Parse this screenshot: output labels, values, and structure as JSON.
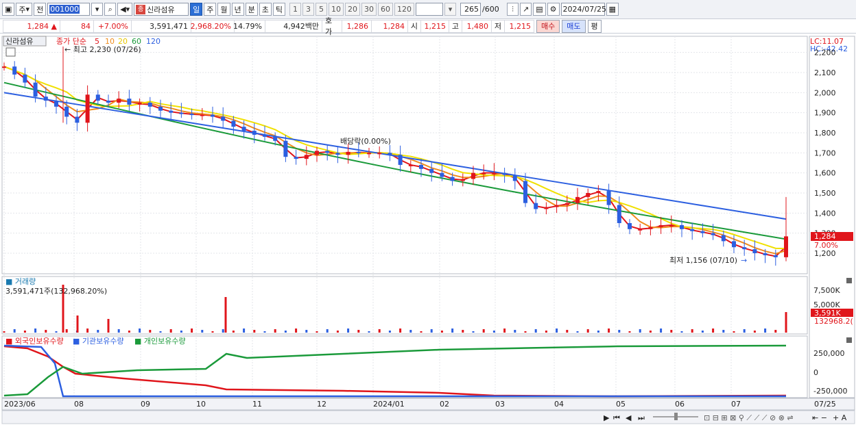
{
  "toolbar": {
    "period_btn": "주",
    "prev_btn": "전",
    "code": "001000",
    "stock_name": "신라섬유",
    "period_tabs": [
      "일",
      "주",
      "월",
      "년",
      "분",
      "초",
      "틱"
    ],
    "interval_tabs": [
      "1",
      "3",
      "5",
      "10",
      "20",
      "30",
      "60",
      "120"
    ],
    "count": "265",
    "count_max": "/600",
    "date": "2024/07/25",
    "logo_char": "종"
  },
  "quote": {
    "price": "1,284",
    "arrow": "▲",
    "change": "84",
    "change_pct": "+7.00%",
    "volume": "3,591,471",
    "volume_ratio": "2,968.20%",
    "turnover": "14.79%",
    "amount": "4,942백만",
    "bid_label": "호가",
    "bid": "1,286",
    "ask": "1,284",
    "open_label": "시",
    "open": "1,215",
    "high_label": "고",
    "high": "1,480",
    "low_label": "저",
    "low": "1,215",
    "buy_btn": "매수",
    "sell_btn": "매도",
    "eval_btn": "평"
  },
  "main_panel": {
    "name_tag": "신라섬유",
    "legend_prefix": "종가 단순",
    "ma_labels": [
      "5",
      "10",
      "20",
      "60",
      "120"
    ],
    "ma_colors": [
      "#e0151b",
      "#f08c1c",
      "#f0e000",
      "#1a9a3a",
      "#2c5fe0"
    ],
    "high_note": "최고 2,230 (07/26)",
    "low_note": "최저 1,156 (07/10)",
    "dividend_note": "배당락(0.00%)",
    "lc": "LC:11.07",
    "hc": "HC:-42.42",
    "y_ticks": [
      "2,200",
      "2,100",
      "2,000",
      "1,900",
      "1,800",
      "1,700",
      "1,600",
      "1,500",
      "1,400",
      "1,300",
      "1,200"
    ],
    "price_tag": "1,284",
    "pct_tag": "7.00%"
  },
  "volume_panel": {
    "title": "거래량",
    "value": "3,591,471주(132,968.20%)",
    "y_ticks": [
      "7,500K",
      "5,000K"
    ],
    "tag": "3,591K",
    "tag2": "132968.2("
  },
  "holdings_panel": {
    "legend": [
      "외국인보유수량",
      "기관보유수량",
      "개인보유수량"
    ],
    "colors": [
      "#e0151b",
      "#2c5fe0",
      "#1a9a3a"
    ],
    "y_ticks": [
      "250,000",
      "0",
      "-250,000"
    ]
  },
  "x_axis": {
    "labels": [
      "2023/06",
      "08",
      "09",
      "10",
      "11",
      "12",
      "2024/01",
      "02",
      "03",
      "04",
      "05",
      "06",
      "07"
    ],
    "last_label": "07/25"
  },
  "chart_data": {
    "type": "candlestick",
    "ohlc_summary": {
      "high": 2230,
      "high_date": "07/26",
      "low": 1156,
      "low_date": "07/10",
      "last_close": 1284
    },
    "close_series": [
      2130,
      2090,
      2050,
      1980,
      1960,
      1930,
      1880,
      1850,
      1990,
      1960,
      1950,
      1970,
      1940,
      1950,
      1930,
      1910,
      1900,
      1895,
      1890,
      1890,
      1880,
      1860,
      1830,
      1810,
      1790,
      1780,
      1760,
      1680,
      1670,
      1690,
      1710,
      1700,
      1690,
      1705,
      1700,
      1700,
      1700,
      1690,
      1640,
      1640,
      1620,
      1600,
      1580,
      1560,
      1570,
      1600,
      1600,
      1600,
      1590,
      1560,
      1450,
      1420,
      1430,
      1440,
      1450,
      1480,
      1500,
      1510,
      1440,
      1350,
      1320,
      1320,
      1330,
      1340,
      1340,
      1320,
      1310,
      1300,
      1290,
      1260,
      1230,
      1220,
      1200,
      1190,
      1180,
      1284
    ],
    "ma_120_range": [
      2000,
      1370
    ],
    "ma_60_range": [
      2050,
      1270
    ]
  }
}
